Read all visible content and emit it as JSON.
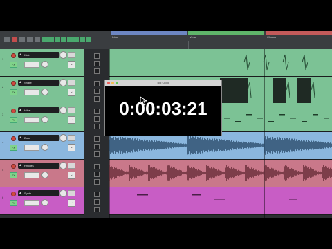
{
  "tracks": [
    {
      "num": "1",
      "name": "Kick",
      "tcp_color": "#7cc295",
      "lane_color": "#7cc295"
    },
    {
      "num": "2",
      "name": "Snare",
      "tcp_color": "#7cc295",
      "lane_color": "#7cc295"
    },
    {
      "num": "3",
      "name": "Hihat",
      "tcp_color": "#7cc295",
      "lane_color": "#7cc295"
    },
    {
      "num": "4",
      "name": "Bass",
      "tcp_color": "#8bb7de",
      "lane_color": "#8bb7de"
    },
    {
      "num": "5",
      "name": "Rhodes",
      "tcp_color": "#c9788a",
      "lane_color": "#c9788a"
    },
    {
      "num": "6",
      "name": "Synth",
      "tcp_color": "#c85dc5",
      "lane_color": "#c85dc5"
    }
  ],
  "fx_label": "FX",
  "regions": [
    {
      "label": "Intro",
      "color": "#6d86c2"
    },
    {
      "label": "Verse",
      "color": "#5fb56a"
    },
    {
      "label": "Chorus",
      "color": "#c35a5a"
    }
  ],
  "big_clock": {
    "title": "Big Clock",
    "time": "0:00:03:21"
  },
  "colors": {
    "screen_bg": "#2b2e31",
    "rec": "#d0483e",
    "fx": "#7fd38a"
  }
}
